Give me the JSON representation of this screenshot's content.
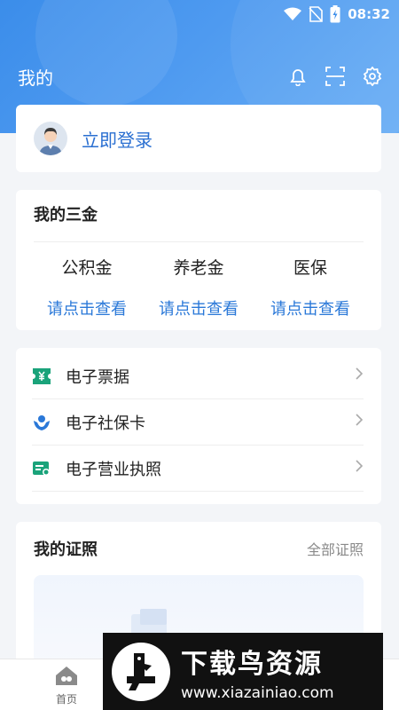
{
  "status_bar": {
    "time": "08:32"
  },
  "header": {
    "title": "我的",
    "icons": [
      "bell-icon",
      "scan-icon",
      "gear-icon"
    ]
  },
  "login": {
    "label": "立即登录"
  },
  "sanjin": {
    "title": "我的三金",
    "items": [
      {
        "name": "公积金",
        "link": "请点击查看"
      },
      {
        "name": "养老金",
        "link": "请点击查看"
      },
      {
        "name": "医保",
        "link": "请点击查看"
      }
    ]
  },
  "services": {
    "items": [
      {
        "label": "电子票据",
        "icon": "ticket-icon"
      },
      {
        "label": "电子社保卡",
        "icon": "social-security-icon"
      },
      {
        "label": "电子营业执照",
        "icon": "business-license-icon"
      }
    ]
  },
  "licenses": {
    "title": "我的证照",
    "more": "全部证照"
  },
  "bottom_nav": {
    "home_label": "首页"
  },
  "watermark": {
    "title": "下载鸟资源",
    "url": "www.xiazainiao.com"
  },
  "colors": {
    "accent": "#2a78d8",
    "header": "#4e9af0"
  }
}
